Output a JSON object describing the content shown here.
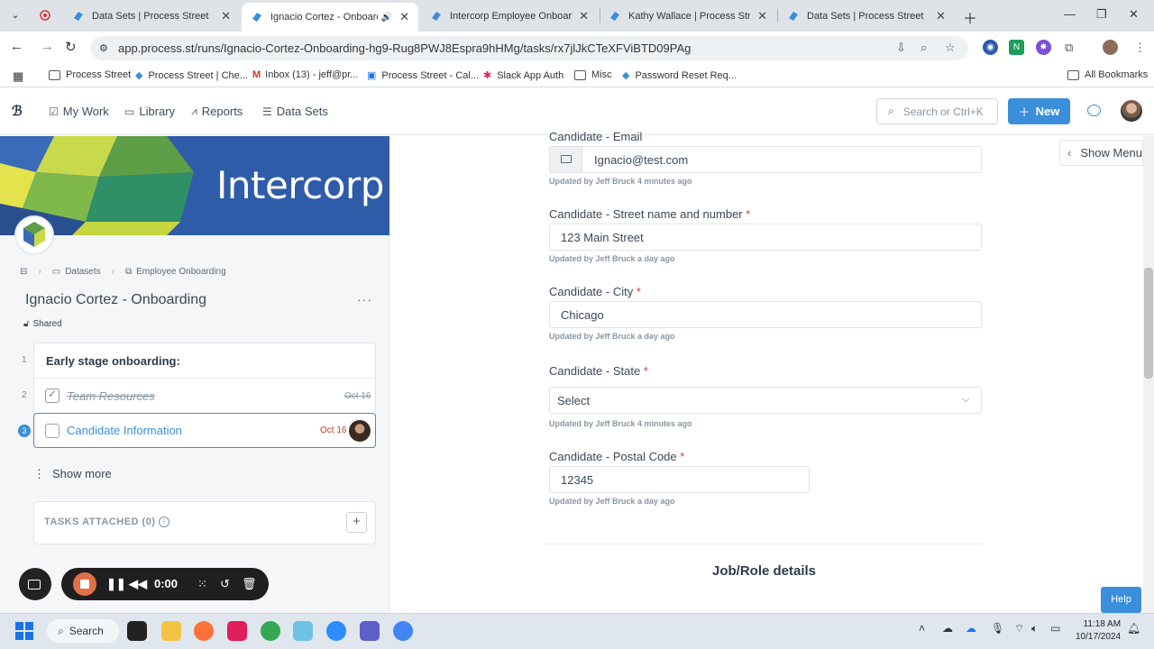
{
  "browser": {
    "tabs": [
      {
        "title": "Data Sets | Process Street"
      },
      {
        "title": "Ignacio Cortez - Onboarding"
      },
      {
        "title": "Intercorp Employee Onboarding"
      },
      {
        "title": "Kathy Wallace | Process Street"
      },
      {
        "title": "Data Sets | Process Street"
      }
    ],
    "url": "app.process.st/runs/Ignacio-Cortez-Onboarding-hg9-Rug8PWJ8Espra9hHMg/tasks/rx7jlJkCTeXFViBTD09PAg",
    "bookmarks": [
      "Process Street",
      "Process Street | Che...",
      "Inbox (13) - jeff@pr...",
      "Process Street - Cal...",
      "Slack App Auth",
      "Misc",
      "Password Reset Req..."
    ],
    "all_bookmarks": "All Bookmarks"
  },
  "app": {
    "nav": [
      "My Work",
      "Library",
      "Reports",
      "Data Sets"
    ],
    "search_placeholder": "Search or Ctrl+K",
    "new_label": "New"
  },
  "sidebar": {
    "banner_text": "Intercorp",
    "breadcrumb": [
      "Datasets",
      "Employee Onboarding"
    ],
    "workflow_title": "Ignacio Cortez - Onboarding",
    "shared_label": "Shared",
    "heading_number": "1",
    "heading": "Early stage onboarding:",
    "tasks": [
      {
        "number": "2",
        "label": "Team Resources",
        "date": "Oct 16",
        "done": true
      },
      {
        "number": "3",
        "label": "Candidate Information",
        "date": "Oct 16",
        "done": false
      }
    ],
    "show_more": "Show more",
    "tasks_attached": "TASKS ATTACHED (0)"
  },
  "recorder": {
    "time": "0:00"
  },
  "form": {
    "fields": [
      {
        "label": "Candidate - Email",
        "value": "Ignacio@test.com",
        "meta": "Updated by Jeff Bruck 4 minutes ago"
      },
      {
        "label": "Candidate - Street name and number",
        "value": "123 Main Street",
        "meta": "Updated by Jeff Bruck a day ago"
      },
      {
        "label": "Candidate - City",
        "value": "Chicago",
        "meta": "Updated by Jeff Bruck a day ago"
      },
      {
        "label": "Candidate - State",
        "value": "Select",
        "meta": "Updated by Jeff Bruck 4 minutes ago"
      },
      {
        "label": "Candidate - Postal Code",
        "value": "12345",
        "meta": "Updated by Jeff Bruck a day ago"
      }
    ],
    "required_mark": "*",
    "section_heading": "Job/Role details"
  },
  "show_menu": "Show Menu",
  "help": "Help",
  "taskbar": {
    "search": "Search",
    "time": "11:18 AM",
    "date": "10/17/2024"
  },
  "colors": {
    "accent": "#3b8ed9",
    "banner": "#2f5ca8",
    "required": "#d14343",
    "due": "#c0392b"
  }
}
